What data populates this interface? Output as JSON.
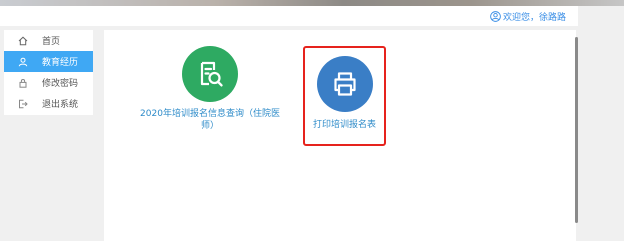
{
  "header": {
    "greeting": "欢迎您，徐路路"
  },
  "sidebar": {
    "items": [
      {
        "label": "首页",
        "icon": "home-icon",
        "active": false
      },
      {
        "label": "教育经历",
        "icon": "user-icon",
        "active": true
      },
      {
        "label": "修改密码",
        "icon": "lock-icon",
        "active": false
      },
      {
        "label": "退出系统",
        "icon": "logout-icon",
        "active": false
      }
    ]
  },
  "main": {
    "tiles": [
      {
        "label": "2020年培训报名信息查询（住院医师）",
        "icon": "document-search-icon",
        "color": "#2eaa62"
      },
      {
        "label": "打印培训报名表",
        "icon": "printer-icon",
        "color": "#3a7ec6"
      }
    ]
  },
  "colors": {
    "accent": "#3fa8f4",
    "highlight": "#e6231d",
    "link": "#2e8bc9"
  }
}
